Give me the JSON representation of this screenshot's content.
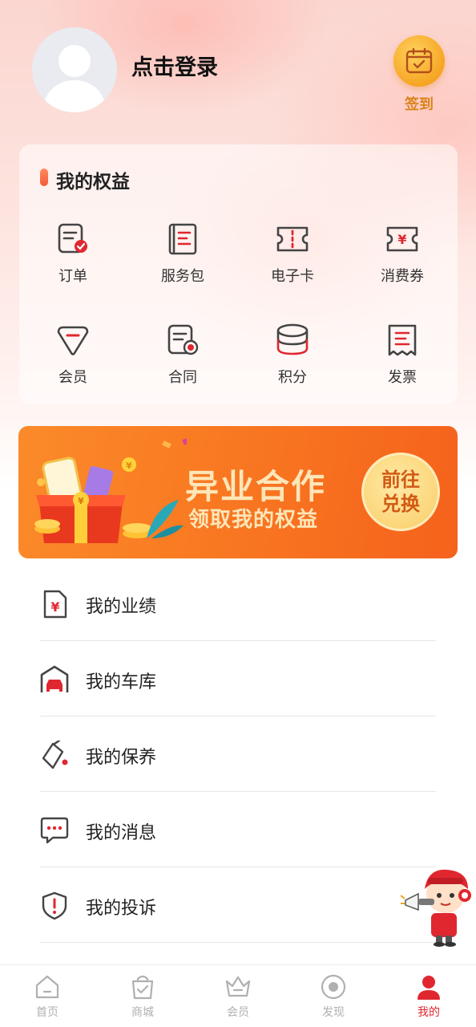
{
  "header": {
    "login_text": "点击登录",
    "checkin_label": "签到"
  },
  "benefits": {
    "title": "我的权益",
    "items": [
      {
        "label": "订单",
        "icon": "order-icon"
      },
      {
        "label": "服务包",
        "icon": "service-package-icon"
      },
      {
        "label": "电子卡",
        "icon": "e-card-icon"
      },
      {
        "label": "消费券",
        "icon": "coupon-icon"
      },
      {
        "label": "会员",
        "icon": "member-icon"
      },
      {
        "label": "合同",
        "icon": "contract-icon"
      },
      {
        "label": "积分",
        "icon": "points-icon"
      },
      {
        "label": "发票",
        "icon": "invoice-icon"
      }
    ]
  },
  "banner": {
    "title": "异业合作",
    "subtitle": "领取我的权益",
    "button_line1": "前往",
    "button_line2": "兑换"
  },
  "menu": [
    {
      "label": "我的业绩",
      "icon": "performance-icon"
    },
    {
      "label": "我的车库",
      "icon": "garage-icon"
    },
    {
      "label": "我的保养",
      "icon": "maintenance-icon"
    },
    {
      "label": "我的消息",
      "icon": "message-icon"
    },
    {
      "label": "我的投诉",
      "icon": "complaint-icon"
    }
  ],
  "bottom_nav": [
    {
      "label": "首页",
      "icon": "home-icon",
      "active": false
    },
    {
      "label": "商城",
      "icon": "mall-icon",
      "active": false
    },
    {
      "label": "会员",
      "icon": "vip-crown-icon",
      "active": false
    },
    {
      "label": "发现",
      "icon": "discover-icon",
      "active": false
    },
    {
      "label": "我的",
      "icon": "profile-icon",
      "active": true
    }
  ],
  "colors": {
    "accent_red": "#e0272f",
    "checkin_orange": "#f6a524",
    "banner_orange": "#f97b22",
    "inactive_gray": "#b0b0b0"
  }
}
